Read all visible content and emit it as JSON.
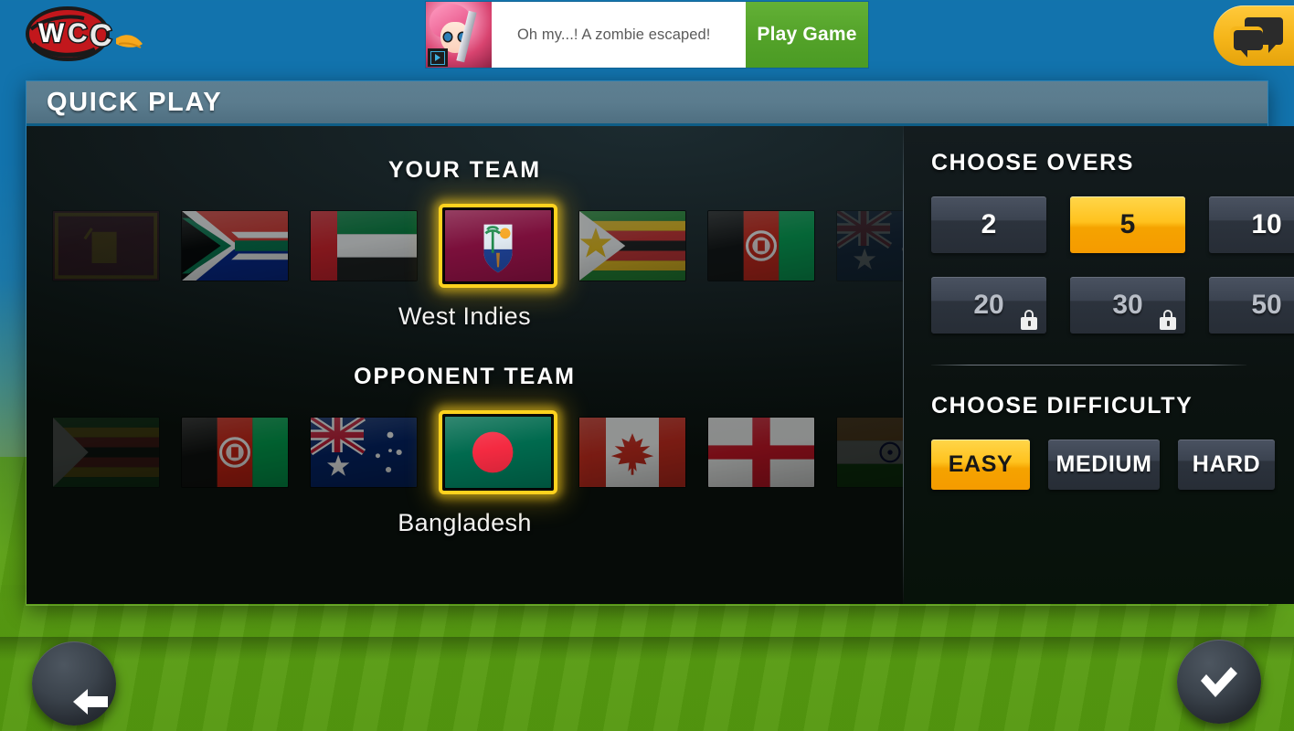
{
  "app": {
    "logo_text": "WCC",
    "logo_alt": "world-cricket-championship-logo"
  },
  "ad": {
    "text": "Oh my...! A zombie escaped!",
    "cta_label": "Play Game",
    "badge": "ad-choices-icon"
  },
  "topbar": {
    "chat_icon": "chat-bubbles-icon"
  },
  "panel": {
    "title": "QUICK PLAY"
  },
  "your_team": {
    "heading": "YOUR TEAM",
    "selected_name": "West Indies",
    "selected_index": 3,
    "flags": [
      {
        "name": "Sri Lanka",
        "code": "sl"
      },
      {
        "name": "South Africa",
        "code": "sa"
      },
      {
        "name": "United Arab Emirates",
        "code": "uae"
      },
      {
        "name": "West Indies",
        "code": "wi"
      },
      {
        "name": "Zimbabwe",
        "code": "zw"
      },
      {
        "name": "Afghanistan",
        "code": "af"
      },
      {
        "name": "Australia",
        "code": "au"
      }
    ]
  },
  "opponent_team": {
    "heading": "OPPONENT TEAM",
    "selected_name": "Bangladesh",
    "selected_index": 3,
    "flags": [
      {
        "name": "Zimbabwe",
        "code": "zw"
      },
      {
        "name": "Afghanistan",
        "code": "af"
      },
      {
        "name": "Australia",
        "code": "au"
      },
      {
        "name": "Bangladesh",
        "code": "bd"
      },
      {
        "name": "Canada",
        "code": "ca"
      },
      {
        "name": "England",
        "code": "en"
      },
      {
        "name": "India",
        "code": "in"
      }
    ]
  },
  "overs": {
    "heading": "CHOOSE OVERS",
    "selected": "5",
    "options": [
      {
        "label": "2",
        "state": "normal"
      },
      {
        "label": "5",
        "state": "selected"
      },
      {
        "label": "10",
        "state": "normal"
      },
      {
        "label": "20",
        "state": "locked"
      },
      {
        "label": "30",
        "state": "locked"
      },
      {
        "label": "50",
        "state": "locked"
      }
    ]
  },
  "difficulty": {
    "heading": "CHOOSE DIFFICULTY",
    "selected": "EASY",
    "options": [
      {
        "label": "EASY",
        "state": "selected"
      },
      {
        "label": "MEDIUM",
        "state": "normal"
      },
      {
        "label": "HARD",
        "state": "normal"
      }
    ]
  },
  "footer": {
    "back_icon": "back-arrow-icon",
    "confirm_icon": "checkmark-icon"
  },
  "colors": {
    "accent_yellow": "#ffc21e",
    "accent_orange": "#f59b00",
    "panel_header": "#5b7c8e",
    "header_underline": "#0e5d86",
    "sky_blue": "#1273ad",
    "grass_green": "#5ba014",
    "button_slate": "#3b4350",
    "cta_green": "#53a229"
  }
}
